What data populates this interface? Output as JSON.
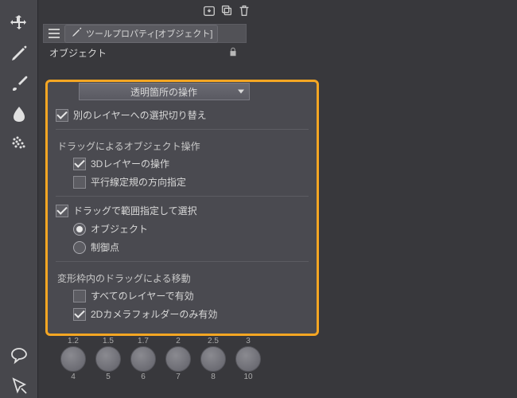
{
  "panel": {
    "tab_label": "ツールプロパティ[オブジェクト]",
    "subheader": "オブジェクト"
  },
  "dropdown": {
    "label": "透明箇所の操作"
  },
  "options": {
    "switch_layer": "別のレイヤーへの選択切り替え",
    "drag_object_section": "ドラッグによるオブジェクト操作",
    "layer3d": "3Dレイヤーの操作",
    "parallel_ruler": "平行線定規の方向指定",
    "drag_range_select": "ドラッグで範囲指定して選択",
    "radio_object": "オブジェクト",
    "radio_ctrl": "制御点",
    "transform_drag_section": "変形枠内のドラッグによる移動",
    "all_layers": "すべてのレイヤーで有効",
    "camera_folder": "2Dカメラフォルダーのみ有効"
  },
  "brushes": {
    "top": [
      "1.2",
      "1.5",
      "1.7",
      "2",
      "2.5",
      "3"
    ],
    "bot": [
      "4",
      "5",
      "6",
      "7",
      "8",
      "10"
    ]
  }
}
